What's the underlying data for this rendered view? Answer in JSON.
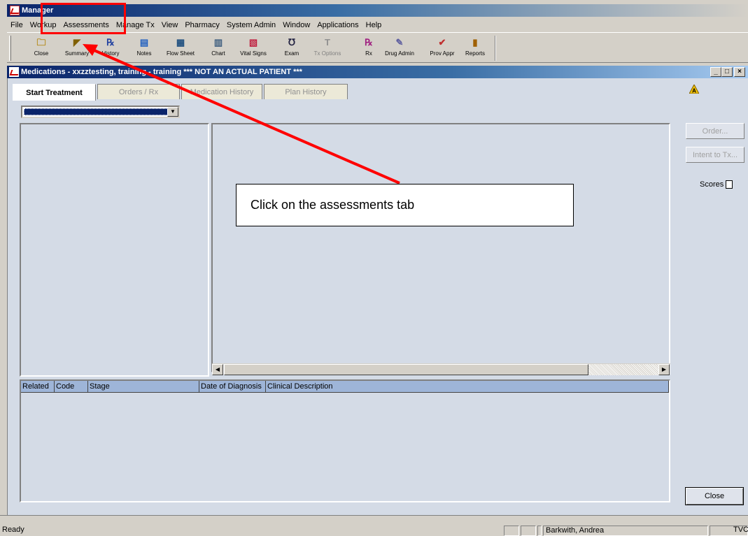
{
  "app": {
    "title": "Manager"
  },
  "menu": [
    "File",
    "Workup",
    "Assessments",
    "Manage Tx",
    "View",
    "Pharmacy",
    "System Admin",
    "Window",
    "Applications",
    "Help"
  ],
  "toolbar": [
    {
      "label": "Close",
      "icon": "folder-icon",
      "glyph": "🗀",
      "color": "#b08000",
      "disabled": false
    },
    {
      "label": "Summary",
      "icon": "summary-icon",
      "glyph": "◤",
      "color": "#806000",
      "disabled": false
    },
    {
      "label": "History",
      "icon": "history-icon",
      "glyph": "℞",
      "color": "#2040a0",
      "disabled": false
    },
    {
      "label": "Notes",
      "icon": "notes-icon",
      "glyph": "▤",
      "color": "#2060c0",
      "disabled": false
    },
    {
      "label": "Flow Sheet",
      "icon": "flow-sheet-icon",
      "glyph": "▦",
      "color": "#205080",
      "disabled": false
    },
    {
      "label": "Chart",
      "icon": "chart-icon",
      "glyph": "▥",
      "color": "#406080",
      "disabled": false
    },
    {
      "label": "Vital Signs",
      "icon": "vital-signs-icon",
      "glyph": "▧",
      "color": "#c02040",
      "disabled": false
    },
    {
      "label": "Exam",
      "icon": "stethoscope-icon",
      "glyph": "℧",
      "color": "#202040",
      "disabled": false
    },
    {
      "label": "Tx Options",
      "icon": "tx-options-icon",
      "glyph": "T",
      "color": "#909090",
      "disabled": true
    },
    {
      "label": "Rx",
      "icon": "rx-icon",
      "glyph": "℞",
      "color": "#a02080",
      "disabled": false
    },
    {
      "label": "Drug Admin",
      "icon": "drug-admin-icon",
      "glyph": "✎",
      "color": "#6060a0",
      "disabled": false
    },
    {
      "label": "Prov Appr",
      "icon": "prov-appr-icon",
      "glyph": "✔",
      "color": "#c03030",
      "disabled": false
    },
    {
      "label": "Reports",
      "icon": "reports-icon",
      "glyph": "▮",
      "color": "#a06000",
      "disabled": false
    }
  ],
  "window": {
    "title": "Medications - xxzztesting, training - training *** NOT AN ACTUAL PATIENT ***",
    "minimize": "_",
    "maximize": "□",
    "close": "×"
  },
  "tabs": [
    {
      "label": "Start Treatment",
      "active": true
    },
    {
      "label": "Orders / Rx",
      "active": false
    },
    {
      "label": "Medication History",
      "active": false
    },
    {
      "label": "Plan History",
      "active": false
    }
  ],
  "warning_icon_letter": "A",
  "combo": {
    "arrow": "▼"
  },
  "scroll": {
    "left": "◀",
    "right": "▶"
  },
  "side_buttons": {
    "order": "Order...",
    "intent": "Intent to Tx...",
    "scores": "Scores",
    "close": "Close"
  },
  "grid_columns": [
    "Related",
    "Code",
    "Stage",
    "Date of Diagnosis",
    "Clinical Description"
  ],
  "status": {
    "left": "Ready",
    "user": "Barkwith, Andrea",
    "right": "TVC"
  },
  "annotation": {
    "text": "Click on the assessments tab",
    "color": "#ff0000"
  }
}
